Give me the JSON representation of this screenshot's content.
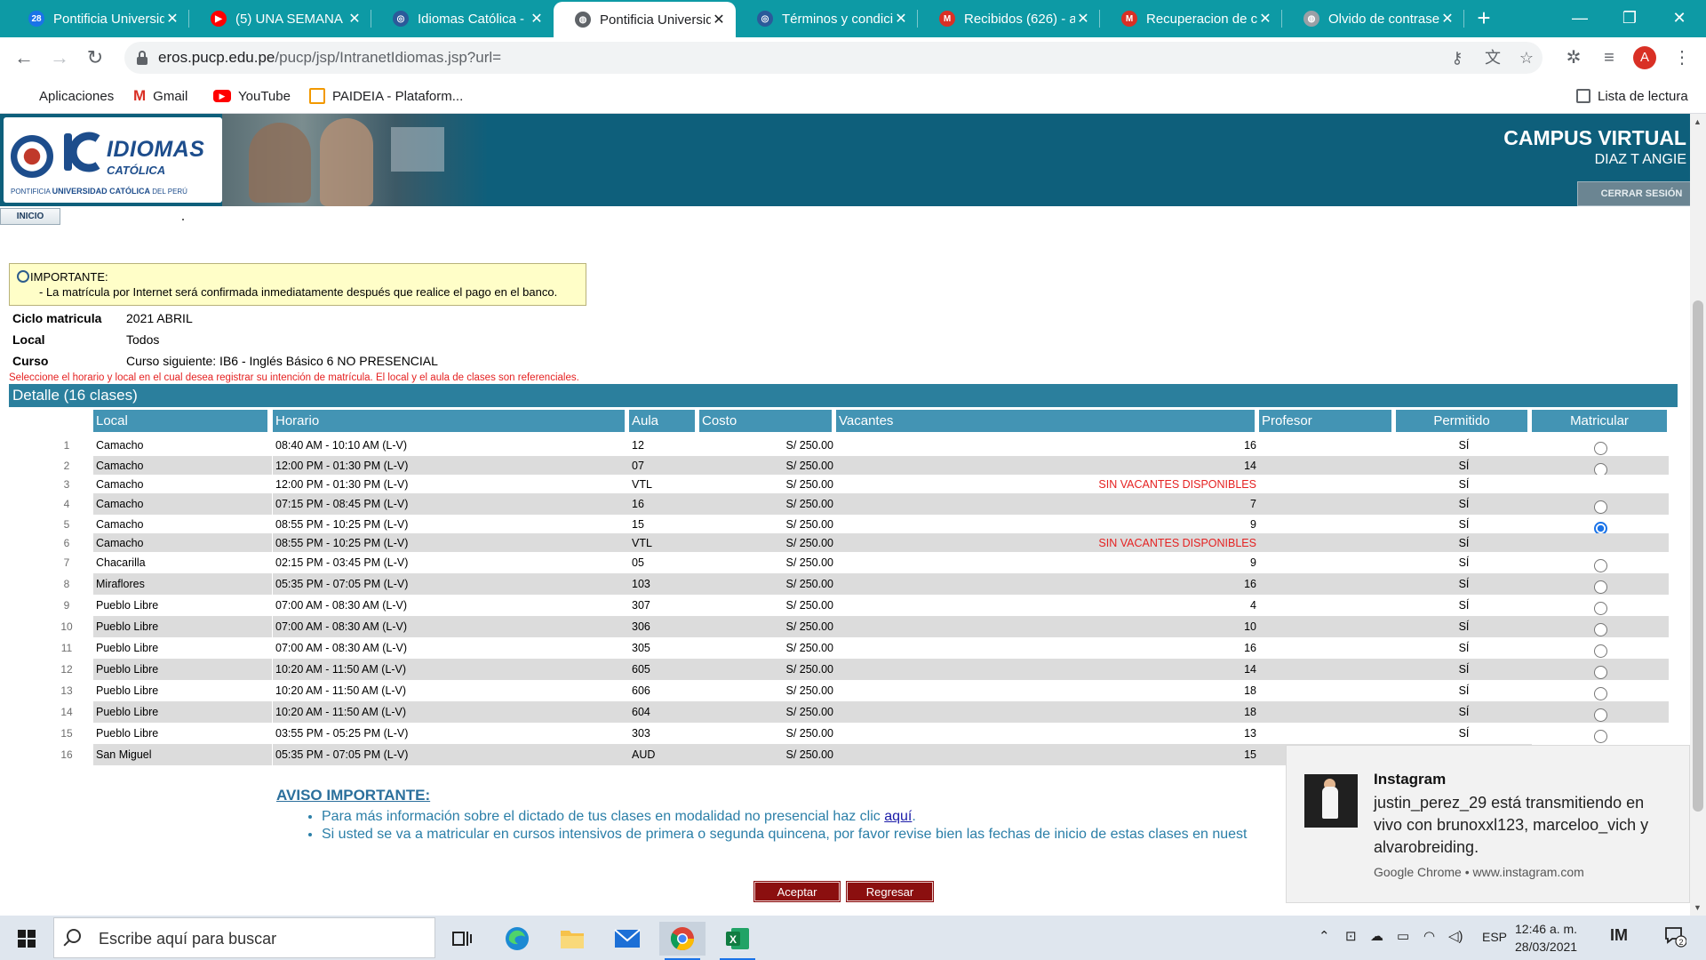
{
  "browser": {
    "tabs": [
      {
        "title": "Pontificia Universid",
        "fav_color": "#1a73e8",
        "fav_text": "28"
      },
      {
        "title": "(5) UNA SEMANA",
        "fav_color": "#ff0000",
        "fav_text": "▶"
      },
      {
        "title": "Idiomas Católica -",
        "fav_color": "#2b5a9a",
        "fav_text": "◎"
      },
      {
        "title": "Pontificia Universid",
        "fav_color": "#5f6368",
        "fav_text": "◍"
      },
      {
        "title": "Términos y condicio",
        "fav_color": "#2b5a9a",
        "fav_text": "◎"
      },
      {
        "title": "Recibidos (626) - a",
        "fav_color": "#d93025",
        "fav_text": "M"
      },
      {
        "title": "Recuperacion de c",
        "fav_color": "#d93025",
        "fav_text": "M"
      },
      {
        "title": "Olvido de contrase",
        "fav_color": "#9aa0a6",
        "fav_text": "◍"
      }
    ],
    "active_tab": 3,
    "new_tab_label": "+",
    "window_controls": {
      "minimize": "—",
      "maximize": "❐",
      "close": "✕"
    },
    "url_host": "eros.pucp.edu.pe",
    "url_path": "/pucp/jsp/IntranetIdiomas.jsp?url=",
    "avatar_letter": "A",
    "bookmarks": [
      "Aplicaciones",
      "Gmail",
      "YouTube",
      "PAIDEIA - Plataform..."
    ],
    "reading_list": "Lista de lectura"
  },
  "header": {
    "logo_name": "IDIOMAS",
    "logo_sub": "CATÓLICA",
    "logo_foot_pre": "PONTIFICIA ",
    "logo_foot_main": "UNIVERSIDAD CATÓLICA",
    "logo_foot_post": " DEL PERÚ",
    "campus_title": "CAMPUS VIRTUAL",
    "user_name": "DIAZ T ANGIE",
    "logout_label": "CERRAR SESIÓN",
    "home_tab": "INICIO"
  },
  "notice": {
    "title": "IMPORTANTE:",
    "text": "- La matrícula por Internet será confirmada inmediatamente después que realice el pago en el banco."
  },
  "info": {
    "ciclo_label": "Ciclo matricula",
    "ciclo_value": "2021 ABRIL",
    "local_label": "Local",
    "local_value": "Todos",
    "curso_label": "Curso",
    "curso_value": "Curso siguiente: IB6 - Inglés Básico 6 NO PRESENCIAL",
    "instruction": "Seleccione el horario y local en el cual desea registrar su intención de matrícula. El local y el aula de clases son referenciales."
  },
  "detail": {
    "heading": "Detalle (16 clases)",
    "columns": [
      "Local",
      "Horario",
      "Aula",
      "Costo",
      "Vacantes",
      "Profesor",
      "Permitido",
      "Matricular"
    ],
    "rows": [
      {
        "n": "1",
        "local": "Camacho",
        "horario": "08:40 AM - 10:10 AM (L-V)",
        "aula": "12",
        "costo": "S/ 250.00",
        "vacantes": "16",
        "profesor": "",
        "permitido": "SÍ",
        "radio": "off"
      },
      {
        "n": "2",
        "local": "Camacho",
        "horario": "12:00 PM - 01:30 PM (L-V)",
        "aula": "07",
        "costo": "S/ 250.00",
        "vacantes": "14",
        "profesor": "",
        "permitido": "SÍ",
        "radio": "off"
      },
      {
        "n": "3",
        "local": "Camacho",
        "horario": "12:00 PM - 01:30 PM (L-V)",
        "aula": "VTL",
        "costo": "S/ 250.00",
        "vacantes": "SIN VACANTES DISPONIBLES",
        "profesor": "",
        "permitido": "SÍ",
        "radio": "none"
      },
      {
        "n": "4",
        "local": "Camacho",
        "horario": "07:15 PM - 08:45 PM (L-V)",
        "aula": "16",
        "costo": "S/ 250.00",
        "vacantes": "7",
        "profesor": "",
        "permitido": "SÍ",
        "radio": "off"
      },
      {
        "n": "5",
        "local": "Camacho",
        "horario": "08:55 PM - 10:25 PM (L-V)",
        "aula": "15",
        "costo": "S/ 250.00",
        "vacantes": "9",
        "profesor": "",
        "permitido": "SÍ",
        "radio": "on"
      },
      {
        "n": "6",
        "local": "Camacho",
        "horario": "08:55 PM - 10:25 PM (L-V)",
        "aula": "VTL",
        "costo": "S/ 250.00",
        "vacantes": "SIN VACANTES DISPONIBLES",
        "profesor": "",
        "permitido": "SÍ",
        "radio": "none"
      },
      {
        "n": "7",
        "local": "Chacarilla",
        "horario": "02:15 PM - 03:45 PM (L-V)",
        "aula": "05",
        "costo": "S/ 250.00",
        "vacantes": "9",
        "profesor": "",
        "permitido": "SÍ",
        "radio": "off"
      },
      {
        "n": "8",
        "local": "Miraflores",
        "horario": "05:35 PM - 07:05 PM (L-V)",
        "aula": "103",
        "costo": "S/ 250.00",
        "vacantes": "16",
        "profesor": "",
        "permitido": "SÍ",
        "radio": "off"
      },
      {
        "n": "9",
        "local": "Pueblo Libre",
        "horario": "07:00 AM - 08:30 AM (L-V)",
        "aula": "307",
        "costo": "S/ 250.00",
        "vacantes": "4",
        "profesor": "",
        "permitido": "SÍ",
        "radio": "off"
      },
      {
        "n": "10",
        "local": "Pueblo Libre",
        "horario": "07:00 AM - 08:30 AM (L-V)",
        "aula": "306",
        "costo": "S/ 250.00",
        "vacantes": "10",
        "profesor": "",
        "permitido": "SÍ",
        "radio": "off"
      },
      {
        "n": "11",
        "local": "Pueblo Libre",
        "horario": "07:00 AM - 08:30 AM (L-V)",
        "aula": "305",
        "costo": "S/ 250.00",
        "vacantes": "16",
        "profesor": "",
        "permitido": "SÍ",
        "radio": "off"
      },
      {
        "n": "12",
        "local": "Pueblo Libre",
        "horario": "10:20 AM - 11:50 AM (L-V)",
        "aula": "605",
        "costo": "S/ 250.00",
        "vacantes": "14",
        "profesor": "",
        "permitido": "SÍ",
        "radio": "off"
      },
      {
        "n": "13",
        "local": "Pueblo Libre",
        "horario": "10:20 AM - 11:50 AM (L-V)",
        "aula": "606",
        "costo": "S/ 250.00",
        "vacantes": "18",
        "profesor": "",
        "permitido": "SÍ",
        "radio": "off"
      },
      {
        "n": "14",
        "local": "Pueblo Libre",
        "horario": "10:20 AM - 11:50 AM (L-V)",
        "aula": "604",
        "costo": "S/ 250.00",
        "vacantes": "18",
        "profesor": "",
        "permitido": "SÍ",
        "radio": "off"
      },
      {
        "n": "15",
        "local": "Pueblo Libre",
        "horario": "03:55 PM - 05:25 PM (L-V)",
        "aula": "303",
        "costo": "S/ 250.00",
        "vacantes": "13",
        "profesor": "",
        "permitido": "SÍ",
        "radio": "off"
      },
      {
        "n": "16",
        "local": "San Miguel",
        "horario": "05:35 PM - 07:05 PM (L-V)",
        "aula": "AUD",
        "costo": "S/ 250.00",
        "vacantes": "15",
        "profesor": "",
        "permitido": "",
        "radio": "none"
      }
    ]
  },
  "aviso": {
    "title": "AVISO IMPORTANTE:",
    "item1_pre": "Para más información sobre el dictado de tus clases en modalidad no presencial haz clic ",
    "item1_link": "aquí",
    "item1_post": ".",
    "item2": "Si usted se va a matricular en cursos intensivos de primera o segunda quincena, por favor revise bien las fechas de inicio de estas clases en nuest"
  },
  "buttons": {
    "accept": "Aceptar",
    "back": "Regresar"
  },
  "notification": {
    "app": "Instagram",
    "message": "justin_perez_29 está transmitiendo en vivo con brunoxxl123, marceloo_vich y alvarobreiding.",
    "source": "Google Chrome • www.instagram.com"
  },
  "taskbar": {
    "search_placeholder": "Escribe aquí para buscar",
    "language": "ESP",
    "time": "12:46 a. m.",
    "date": "28/03/2021",
    "notif_count": "2"
  }
}
